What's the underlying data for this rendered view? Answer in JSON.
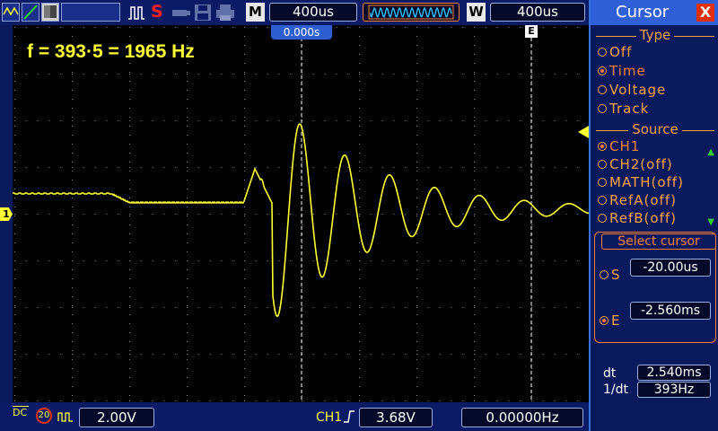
{
  "toolbar": {
    "icons": [
      "waveform-icon",
      "trigger-edge-icon",
      "image-icon",
      "pulse-icon",
      "stop-icon",
      "usb-icon",
      "save-icon",
      "print-icon"
    ],
    "run_status": "S",
    "timebase_letter": "M",
    "timebase": "400us",
    "window_letter": "W",
    "window_timebase": "400us"
  },
  "screen": {
    "annotation": "f = 393·5 = 1965 Hz",
    "cursor_time_tag": "0.000s",
    "cursor_e_label": "E"
  },
  "channel": {
    "marker": "1"
  },
  "bottom": {
    "coupling": "DC",
    "bw_limit": "20",
    "ch1_scale": "2.00V",
    "trigger_source": "CH1",
    "trigger_level": "3.68V",
    "frequency": "0.00000Hz"
  },
  "panel": {
    "title": "Cursor",
    "close": "X",
    "type_title": "Type",
    "type_options": [
      "Off",
      "Time",
      "Voltage",
      "Track"
    ],
    "type_selected": 1,
    "source_title": "Source",
    "source_options": [
      "CH1",
      "CH2(off)",
      "MATH(off)",
      "RefA(off)",
      "RefB(off)"
    ],
    "source_selected": 0,
    "select_cursor_title": "Select cursor",
    "s_label": "S",
    "s_value": "-20.00us",
    "e_label": "E",
    "e_value": "-2.560ms",
    "dt_label": "dt",
    "dt_value": "2.540ms",
    "inv_dt_label": "1/dt",
    "inv_dt_value": "393Hz"
  },
  "colors": {
    "trace": "#ffff33",
    "accent_orange": "#ff8030",
    "panel_blue": "#3060d8",
    "cursor_tag_blue": "#2d5fd0"
  }
}
